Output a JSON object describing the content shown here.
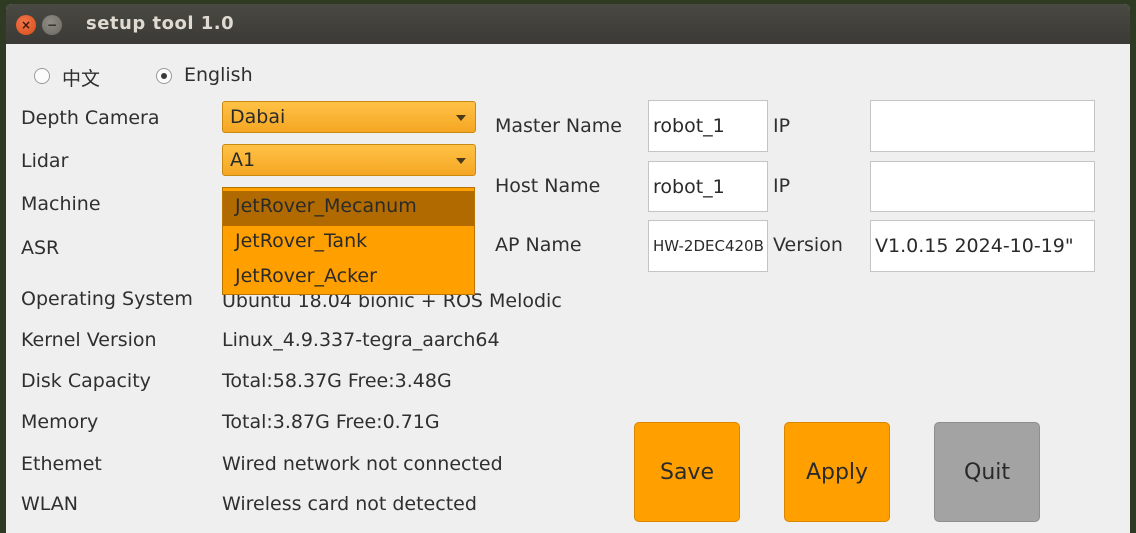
{
  "window": {
    "title": "setup tool 1.0",
    "close_glyph": "×",
    "minimize_glyph": "−"
  },
  "language": {
    "options": [
      {
        "label": "中文",
        "checked": false
      },
      {
        "label": "English",
        "checked": true
      }
    ]
  },
  "labels": {
    "depth_camera": "Depth Camera",
    "lidar": "Lidar",
    "machine": "Machine",
    "asr": "ASR",
    "operating_system": "Operating System",
    "kernel_version": "Kernel Version",
    "disk_capacity": "Disk Capacity",
    "memory": "Memory",
    "ethernet": "Ethemet",
    "wlan": "WLAN",
    "master_name": "Master Name",
    "host_name": "Host Name",
    "ap_name": "AP Name",
    "ip_1": "IP",
    "ip_2": "IP",
    "version": "Version"
  },
  "combos": {
    "depth_camera": "Dabai",
    "lidar": "A1"
  },
  "machine_dropdown": {
    "options": [
      "JetRover_Mecanum",
      "JetRover_Tank",
      "JetRover_Acker"
    ],
    "selected_index": 0
  },
  "info": {
    "operating_system": "Ubuntu 18.04 bionic + ROS Melodic",
    "kernel_version": "Linux_4.9.337-tegra_aarch64",
    "disk_capacity": "Total:58.37G  Free:3.48G",
    "memory": "Total:3.87G  Free:0.71G",
    "ethernet": "Wired network not connected",
    "wlan": "Wireless card not detected"
  },
  "fields": {
    "master_name": "robot_1",
    "host_name": "robot_1",
    "ap_name": "HW-2DEC420B",
    "master_ip": "",
    "host_ip": "",
    "version": "V1.0.15  2024-10-19\""
  },
  "buttons": {
    "save": "Save",
    "apply": "Apply",
    "quit": "Quit"
  },
  "colors": {
    "accent_orange": "#ffa000",
    "selected_option": "#b06a00",
    "quit_gray": "#a3a3a3"
  }
}
